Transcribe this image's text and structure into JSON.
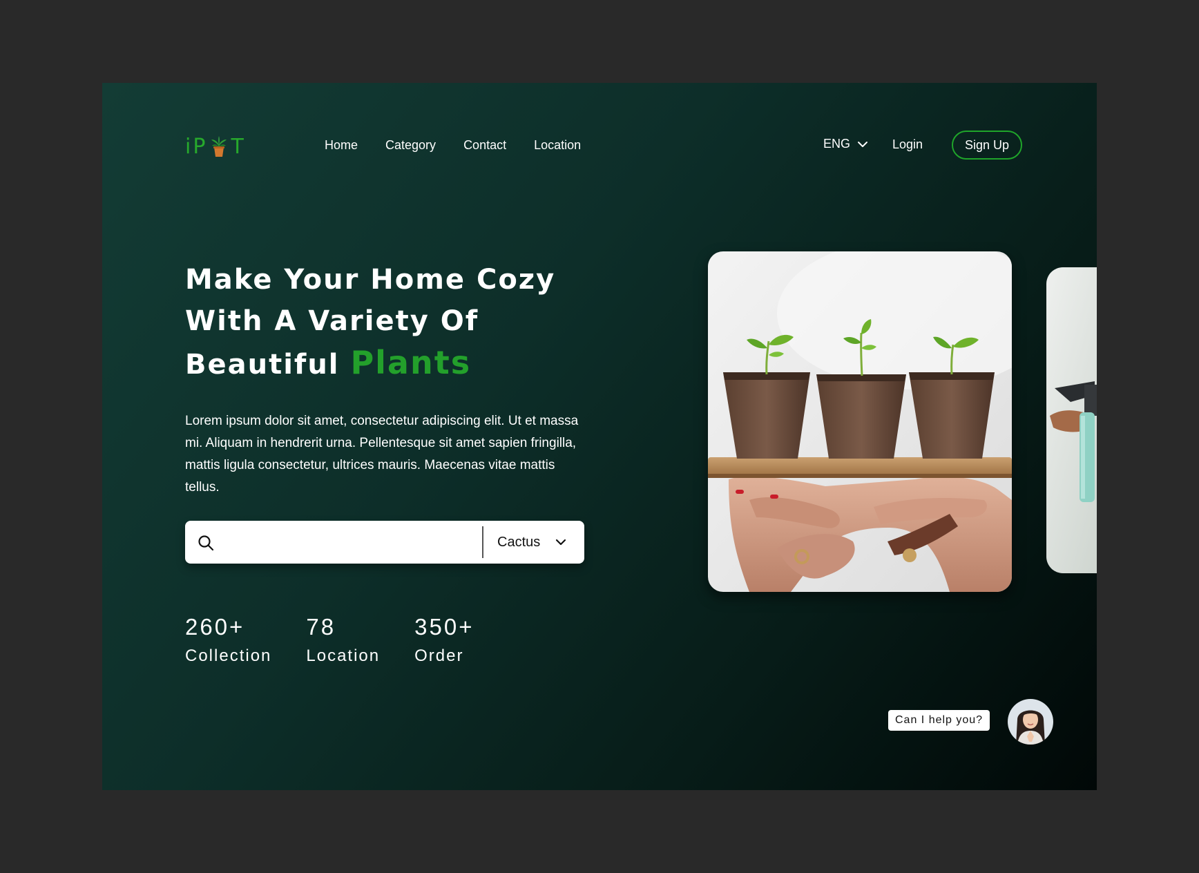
{
  "brand": {
    "logo_prefix": "iP",
    "logo_suffix": "T",
    "logo_color": "#27a92c"
  },
  "nav": {
    "items": [
      {
        "label": "Home"
      },
      {
        "label": "Category"
      },
      {
        "label": "Contact"
      },
      {
        "label": "Location"
      }
    ]
  },
  "header": {
    "language": "ENG",
    "login_label": "Login",
    "signup_label": "Sign Up"
  },
  "hero": {
    "headline_line1": "Make Your Home Cozy",
    "headline_line2": "With A Variety Of",
    "headline_line3": "Beautiful",
    "headline_accent": "Plants",
    "accent_color": "#23a02b",
    "description": "Lorem ipsum dolor sit amet, consectetur adipiscing elit. Ut et massa mi. Aliquam in hendrerit urna. Pellentesque sit amet sapien fringilla, mattis ligula consectetur, ultrices mauris. Maecenas vitae mattis tellus."
  },
  "search": {
    "value": "",
    "placeholder": "",
    "category": "Cactus"
  },
  "stats": [
    {
      "value": "260+",
      "label": "Collection"
    },
    {
      "value": "78",
      "label": "Location"
    },
    {
      "value": "350+",
      "label": "Order"
    }
  ],
  "chat": {
    "prompt": "Can I help you?"
  },
  "icons": {
    "search": "search-icon",
    "language_caret": "chevron-down-icon",
    "category_caret": "chevron-down-icon",
    "logo": "plant-pot-icon"
  }
}
